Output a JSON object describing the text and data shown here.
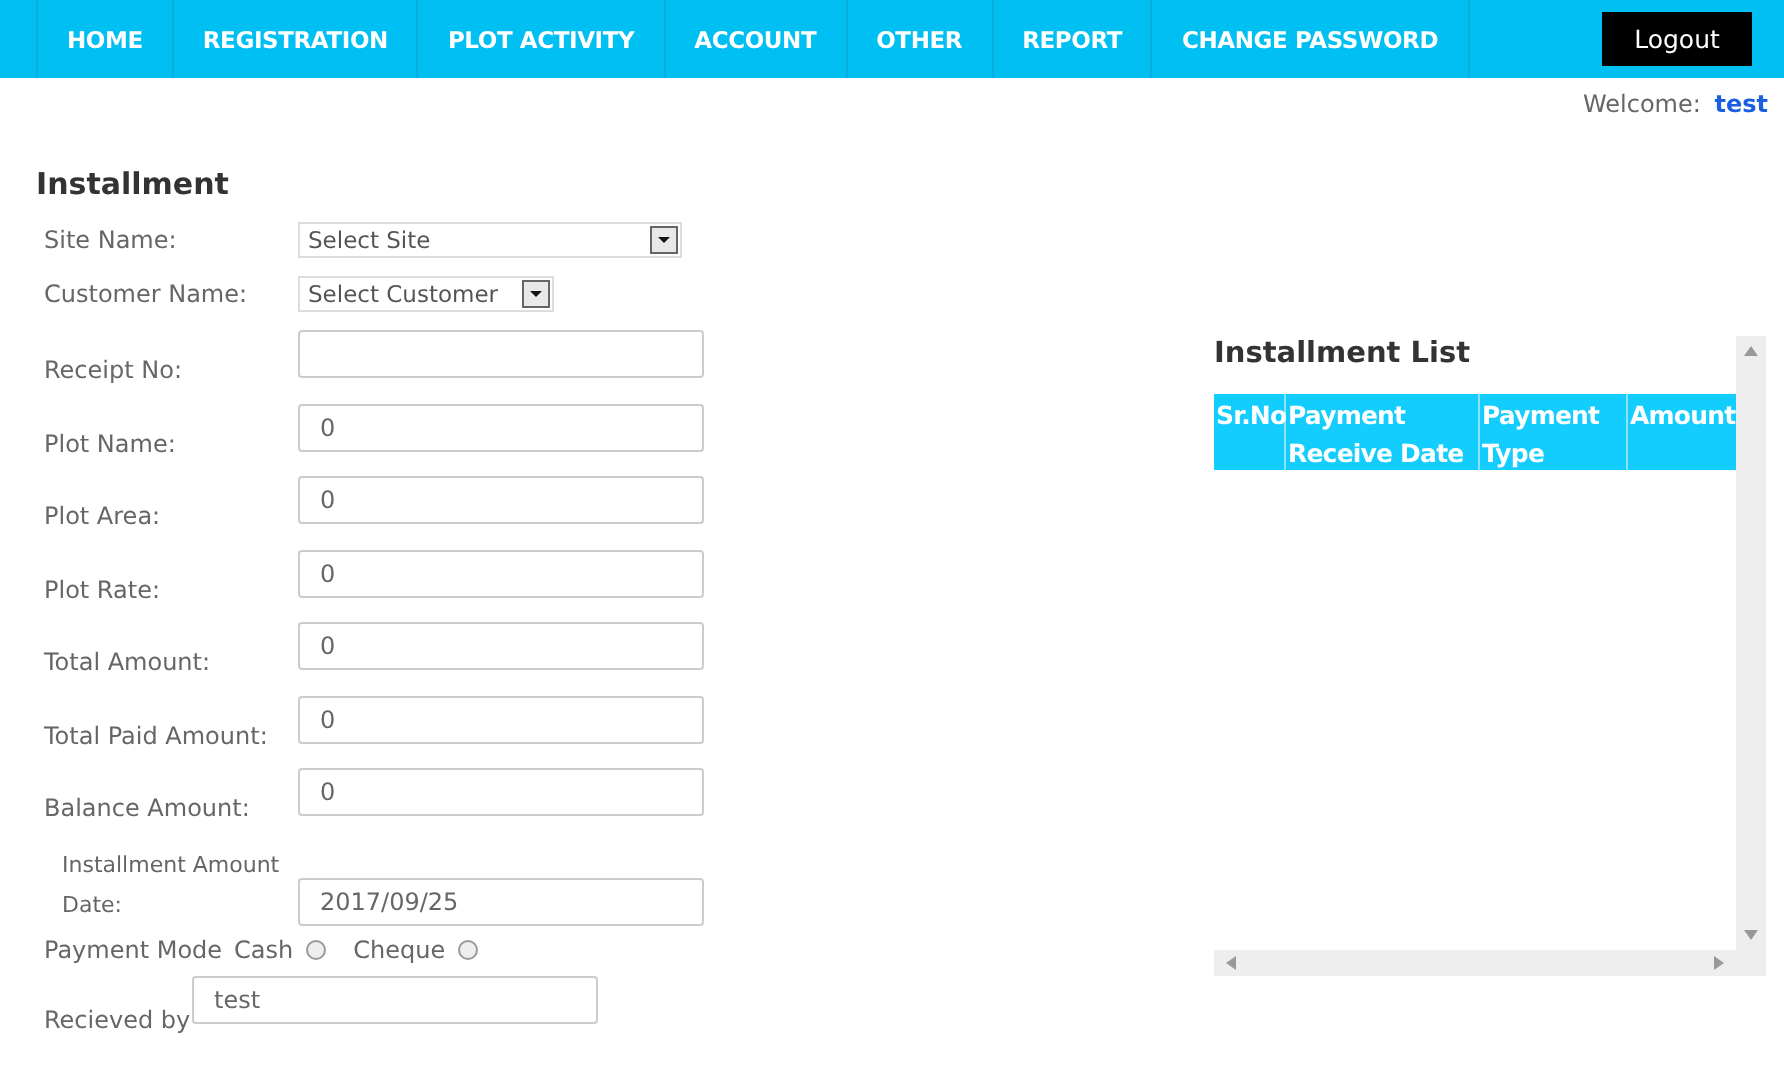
{
  "nav": {
    "items": [
      "HOME",
      "REGISTRATION",
      "PLOT ACTIVITY",
      "ACCOUNT",
      "OTHER",
      "REPORT",
      "CHANGE PASSWORD"
    ],
    "logout": "Logout"
  },
  "welcome": {
    "label": "Welcome:",
    "user": "test"
  },
  "form": {
    "title": "Installment",
    "fields": [
      {
        "label": "Site Name:",
        "kind": "select",
        "value": "Select Site"
      },
      {
        "label": "Customer Name:",
        "kind": "select-small",
        "value": "Select Customer"
      },
      {
        "label": "Receipt No:",
        "kind": "input"
      },
      {
        "label": "Plot Name:",
        "kind": "input",
        "value": "0"
      },
      {
        "label": "Plot Area:",
        "kind": "input",
        "value": "0"
      },
      {
        "label": "Plot Rate:",
        "kind": "input",
        "value": "0"
      },
      {
        "label": "Total Amount:",
        "kind": "input",
        "value": "0"
      },
      {
        "label": "Total Paid Amount:",
        "kind": "input",
        "value": "0"
      },
      {
        "label": "Balance Amount:",
        "kind": "input",
        "value": "0"
      },
      {
        "label": "Installment Amount Date:",
        "kind": "date",
        "value": "2017/09/25"
      }
    ],
    "payment_mode": {
      "label": "Payment Mode",
      "options": [
        {
          "label": "Cash",
          "selected": false
        },
        {
          "label": "Cheque",
          "selected": false
        }
      ]
    },
    "received_by": {
      "label": "Recieved by",
      "value": "test"
    }
  },
  "installment_list": {
    "title": "Installment List",
    "columns": [
      "Sr.No",
      "Payment Receive Date",
      "Payment Type",
      "Amount"
    ]
  }
}
